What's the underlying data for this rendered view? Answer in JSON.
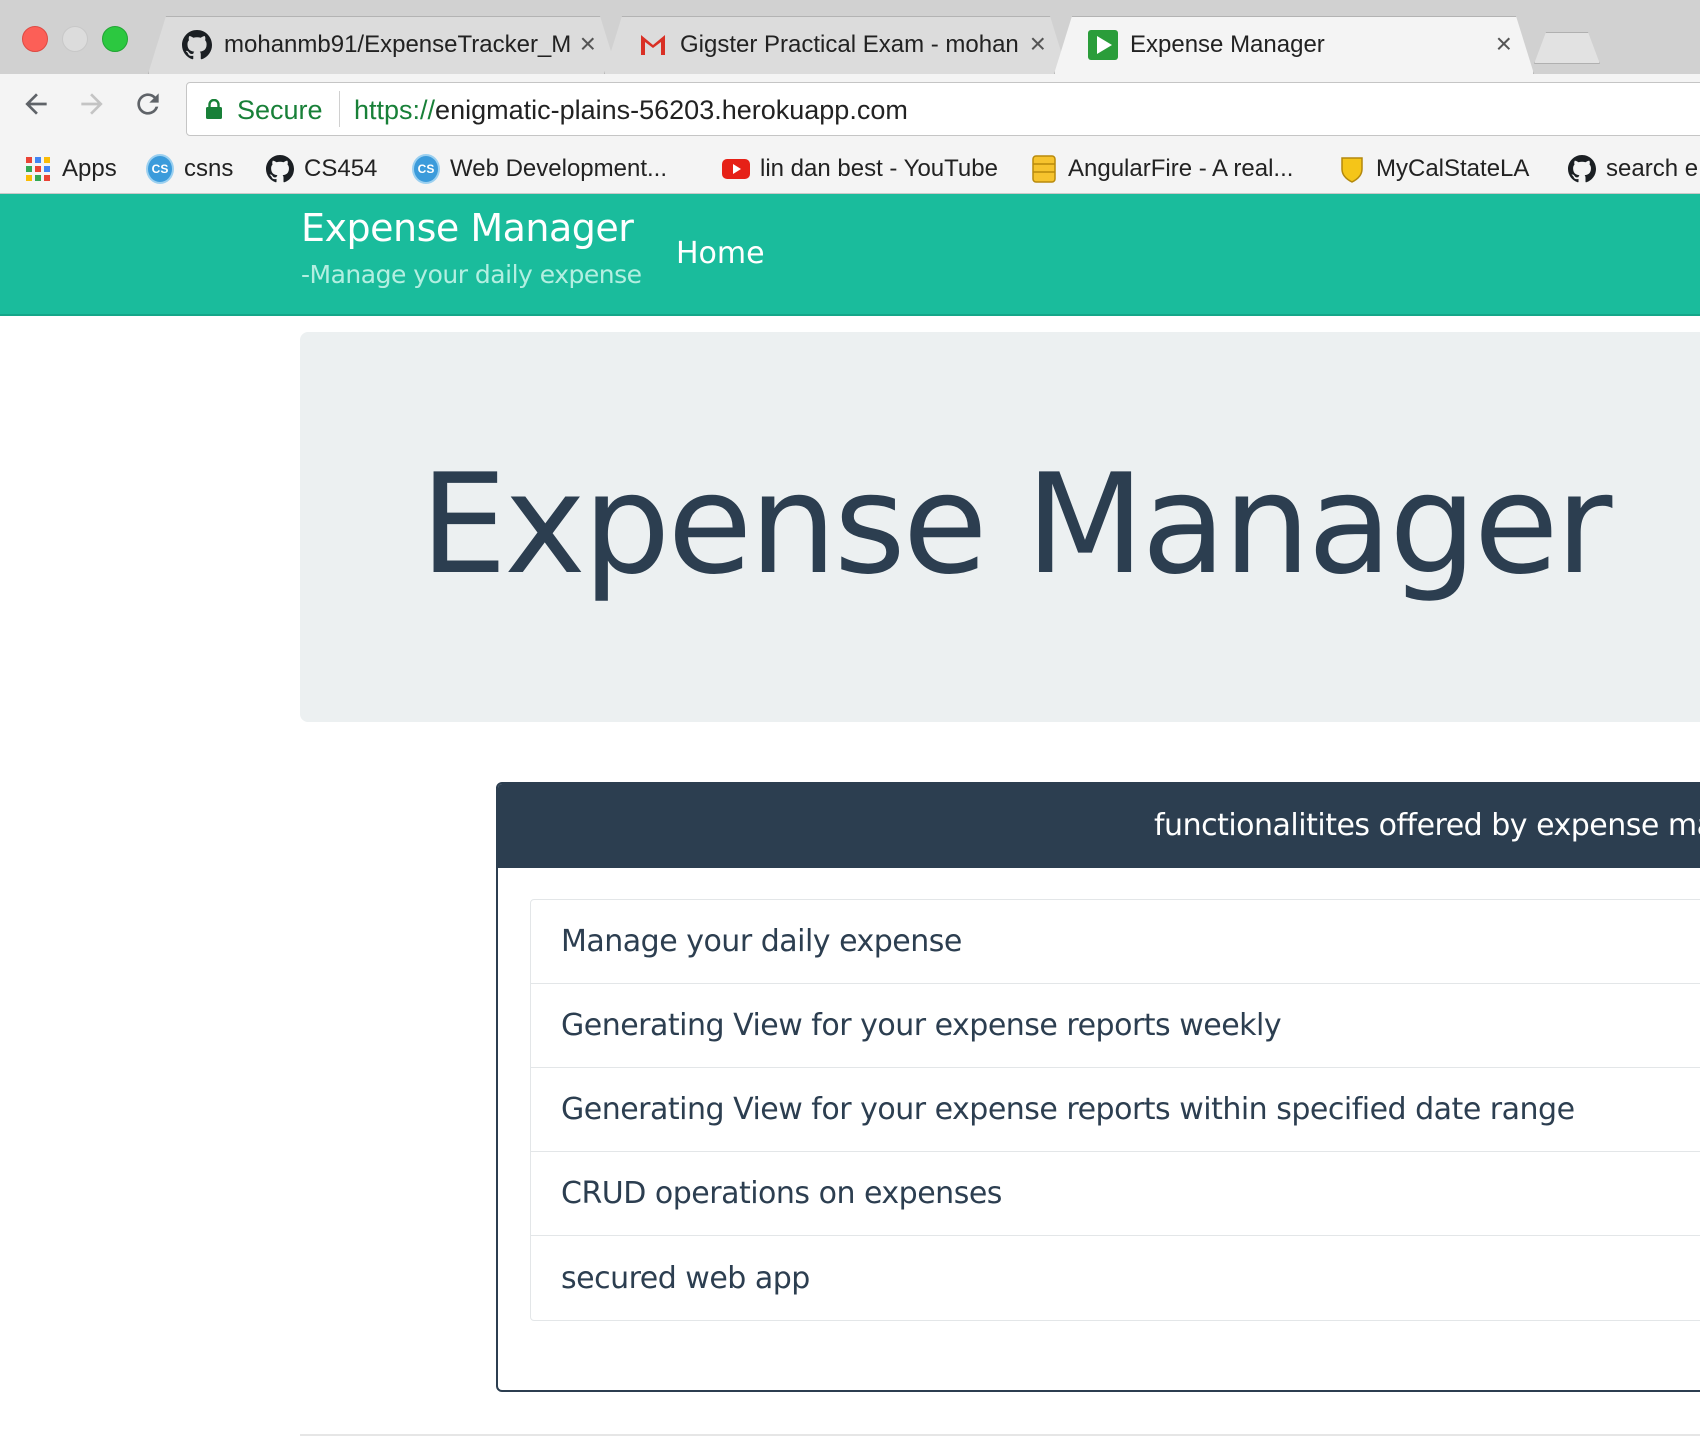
{
  "browser": {
    "tabs": [
      {
        "title": "mohanmb91/ExpenseTracker_M",
        "icon": "github-icon",
        "active": false
      },
      {
        "title": "Gigster Practical Exam - mohan",
        "icon": "gmail-icon",
        "active": false
      },
      {
        "title": "Expense Manager",
        "icon": "play-icon",
        "active": true
      }
    ],
    "close_glyph": "×",
    "security_label": "Secure",
    "url_scheme": "https://",
    "url_host": "enigmatic-plains-56203.herokuapp.com",
    "bookmarks": [
      {
        "label": "Apps",
        "icon": "apps-grid-icon"
      },
      {
        "label": "csns",
        "icon": "cs-icon"
      },
      {
        "label": "CS454",
        "icon": "github-icon"
      },
      {
        "label": "Web Development...",
        "icon": "cs-icon"
      },
      {
        "label": "lin dan best - YouTube",
        "icon": "youtube-icon"
      },
      {
        "label": "AngularFire - A real...",
        "icon": "database-icon"
      },
      {
        "label": "MyCalStateLA",
        "icon": "shield-icon"
      },
      {
        "label": "search e",
        "icon": "github-icon"
      }
    ]
  },
  "navbar": {
    "brand": "Expense Manager",
    "tagline": "-Manage your daily expense",
    "home": "Home",
    "color": "#1abc9c"
  },
  "jumbotron": {
    "heading": "Expense Manager"
  },
  "panel": {
    "title": "functionalitites offered by expense manag",
    "items": [
      "Manage your daily expense",
      "Generating View for your expense reports weekly",
      "Generating View for your expense reports within specified date range",
      "CRUD operations on expenses",
      "secured web app"
    ],
    "heading_color": "#2c3e50"
  }
}
